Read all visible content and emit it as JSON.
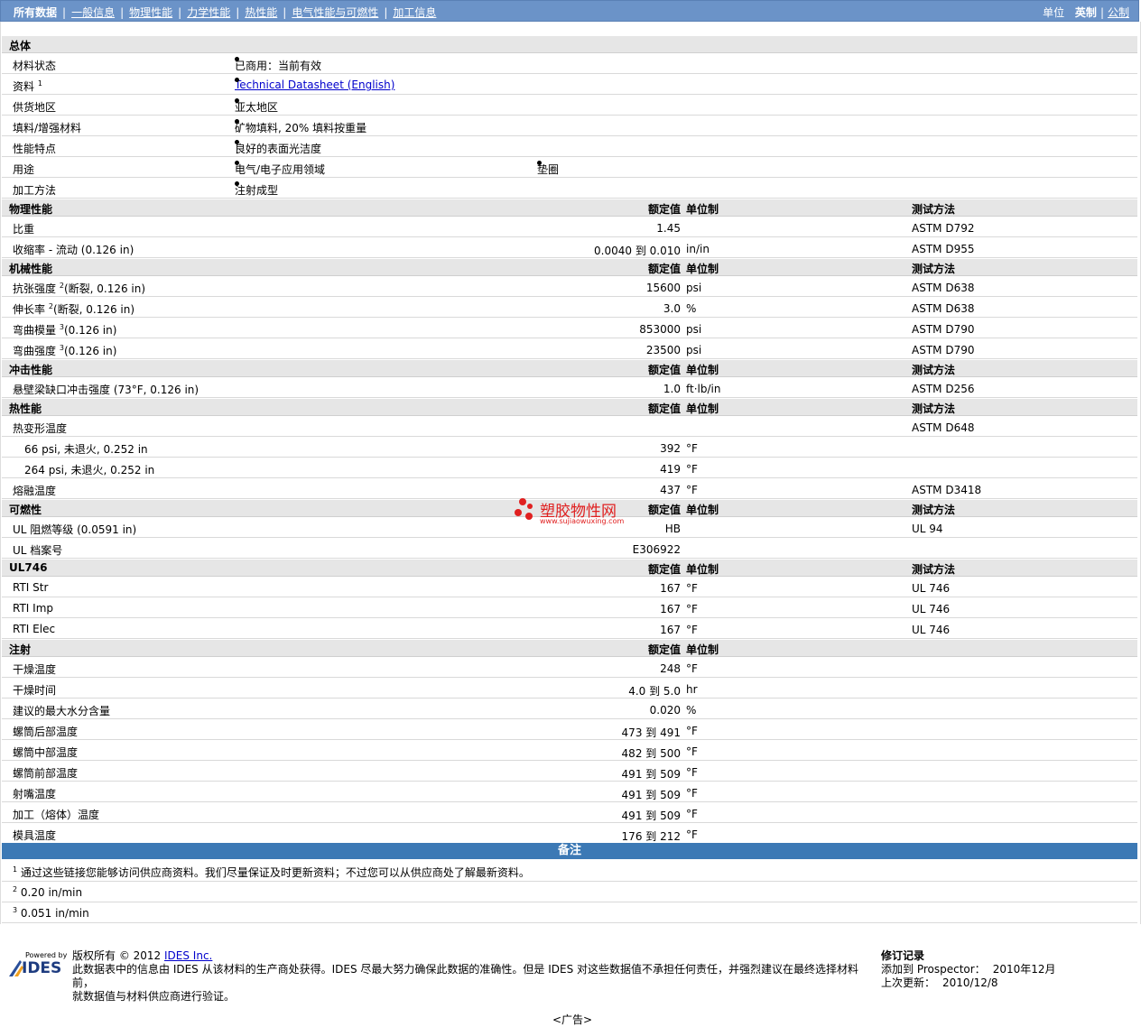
{
  "nav": {
    "items": [
      "所有数据",
      "一般信息",
      "物理性能",
      "力学性能",
      "热性能",
      "电气性能与可燃性",
      "加工信息"
    ],
    "units_label": "单位",
    "unit_imperial": "英制",
    "unit_metric": "公制"
  },
  "general": {
    "title": "总体",
    "rows": [
      {
        "label": "材料状态",
        "value": "已商用：当前有效"
      },
      {
        "label": "资料",
        "sup": "1",
        "link": "Technical Datasheet (English)"
      },
      {
        "label": "供货地区",
        "value": "亚太地区"
      },
      {
        "label": "填料/增强材料",
        "value": "矿物填料, 20% 填料按重量"
      },
      {
        "label": "性能特点",
        "value": "良好的表面光洁度"
      },
      {
        "label": "用途",
        "value": "电气/电子应用领域",
        "value2": "垫圈"
      },
      {
        "label": "加工方法",
        "value": "注射成型"
      }
    ]
  },
  "headers": {
    "rated": "额定值",
    "unit": "单位制",
    "method": "测试方法"
  },
  "physical": {
    "title": "物理性能",
    "rows": [
      {
        "label": "比重",
        "value": "1.45",
        "unit": "",
        "method": "ASTM D792"
      },
      {
        "label": "收缩率 - 流动  (0.126 in)",
        "value": "0.0040 到  0.010",
        "unit": "in/in",
        "method": "ASTM D955"
      }
    ]
  },
  "mechanical": {
    "title": "机械性能",
    "rows": [
      {
        "label": "抗张强度",
        "sup": "2",
        "cond": "(断裂, 0.126 in)",
        "value": "15600",
        "unit": "psi",
        "method": "ASTM D638"
      },
      {
        "label": "伸长率",
        "sup": "2",
        "cond": "(断裂, 0.126 in)",
        "value": "3.0",
        "unit": "%",
        "method": "ASTM D638"
      },
      {
        "label": "弯曲模量",
        "sup": "3",
        "cond": "(0.126 in)",
        "value": "853000",
        "unit": "psi",
        "method": "ASTM D790"
      },
      {
        "label": "弯曲强度",
        "sup": "3",
        "cond": "(0.126 in)",
        "value": "23500",
        "unit": "psi",
        "method": "ASTM D790"
      }
    ]
  },
  "impact": {
    "title": "冲击性能",
    "rows": [
      {
        "label": "悬壁梁缺口冲击强度  (73°F, 0.126 in)",
        "value": "1.0",
        "unit": "ft·lb/in",
        "method": "ASTM D256"
      }
    ]
  },
  "thermal": {
    "title": "热性能",
    "rows": [
      {
        "label": "热变形温度",
        "value": "",
        "unit": "",
        "method": "ASTM D648"
      },
      {
        "label": "66 psi, 未退火, 0.252 in",
        "value": "392",
        "unit": "°F",
        "method": "",
        "sub": true
      },
      {
        "label": "264 psi, 未退火, 0.252 in",
        "value": "419",
        "unit": "°F",
        "method": "",
        "sub": true
      },
      {
        "label": "熔融温度",
        "value": "437",
        "unit": "°F",
        "method": "ASTM D3418"
      }
    ]
  },
  "flammability": {
    "title": "可燃性",
    "rows": [
      {
        "label": "UL 阻燃等级  (0.0591 in)",
        "value": "HB",
        "unit": "",
        "method": "UL 94"
      },
      {
        "label": "UL 档案号",
        "value": "E306922",
        "unit": "",
        "method": ""
      }
    ]
  },
  "ul746": {
    "title": "UL746",
    "rows": [
      {
        "label": "RTI Str",
        "value": "167",
        "unit": "°F",
        "method": "UL 746"
      },
      {
        "label": "RTI Imp",
        "value": "167",
        "unit": "°F",
        "method": "UL 746"
      },
      {
        "label": "RTI Elec",
        "value": "167",
        "unit": "°F",
        "method": "UL 746"
      }
    ]
  },
  "injection": {
    "title": "注射",
    "rows": [
      {
        "label": "干燥温度",
        "value": "248",
        "unit": "°F"
      },
      {
        "label": "干燥时间",
        "value": "4.0 到  5.0",
        "unit": "hr"
      },
      {
        "label": "建议的最大水分含量",
        "value": "0.020",
        "unit": "%"
      },
      {
        "label": "螺筒后部温度",
        "value": "473 到  491",
        "unit": "°F"
      },
      {
        "label": "螺筒中部温度",
        "value": "482 到  500",
        "unit": "°F"
      },
      {
        "label": "螺筒前部温度",
        "value": "491 到  509",
        "unit": "°F"
      },
      {
        "label": "射嘴温度",
        "value": "491 到  509",
        "unit": "°F"
      },
      {
        "label": "加工（熔体）温度",
        "value": "491 到  509",
        "unit": "°F"
      },
      {
        "label": "模具温度",
        "value": "176 到  212",
        "unit": "°F"
      }
    ]
  },
  "notes": {
    "title": "备注",
    "items": [
      {
        "num": "1",
        "text": "通过这些链接您能够访问供应商资料。我们尽量保证及时更新资料；不过您可以从供应商处了解最新资料。"
      },
      {
        "num": "2",
        "text": "0.20 in/min"
      },
      {
        "num": "3",
        "text": "0.051 in/min"
      }
    ]
  },
  "watermark": {
    "main": "塑胶物性网",
    "sub": "www.sujiaowuxing.com"
  },
  "footer": {
    "powered_by": "Powered by",
    "logo_text": "IDES",
    "copyright_prefix": "版权所有  © 2012",
    "copyright_link": "IDES Inc.",
    "disclaimer_1": "此数据表中的信息由  IDES 从该材料的生产商处获得。IDES 尽最大努力确保此数据的准确性。但是  IDES 对这些数据值不承担任何责任，并强烈建议在最终选择材料前，",
    "disclaimer_2": "就数据值与材料供应商进行验证。",
    "revision_title": "修订记录",
    "added_label": "添加到  Prospector：",
    "added_value": "2010年12月",
    "updated_label": "上次更新：",
    "updated_value": "2010/12/8"
  },
  "ad": "<广告>"
}
